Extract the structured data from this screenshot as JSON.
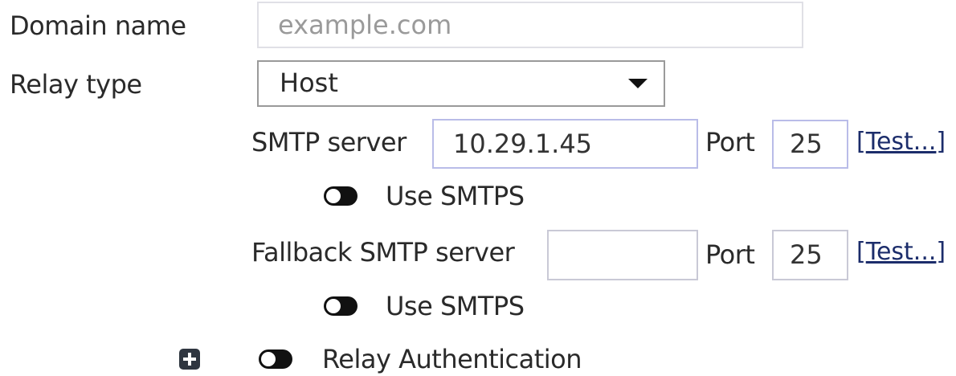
{
  "form": {
    "domain_name": {
      "label": "Domain name",
      "placeholder": "example.com",
      "value": ""
    },
    "relay_type": {
      "label": "Relay type",
      "selected": "Host"
    },
    "smtp": {
      "label": "SMTP server",
      "value": "10.29.1.45",
      "port_label": "Port",
      "port_value": "25",
      "test_bracket_open": "[",
      "test_label": "Test...",
      "test_bracket_close": "]",
      "use_smtps_label": "Use SMTPS"
    },
    "fallback_smtp": {
      "label": "Fallback SMTP server",
      "value": "",
      "port_label": "Port",
      "port_value": "25",
      "test_bracket_open": "[",
      "test_label": "Test...",
      "test_bracket_close": "]",
      "use_smtps_label": "Use SMTPS"
    },
    "relay_authentication": {
      "label": "Relay Authentication"
    }
  },
  "colors": {
    "text": "#2a2a2a",
    "link": "#1c2d6b",
    "toggle": "#111111",
    "input_border": "#c9c9d6",
    "placeholder": "#9a9a9a"
  },
  "icons": {
    "expand": "plus-square-icon",
    "toggle": "toggle-off-icon",
    "dropdown": "caret-down-icon"
  }
}
